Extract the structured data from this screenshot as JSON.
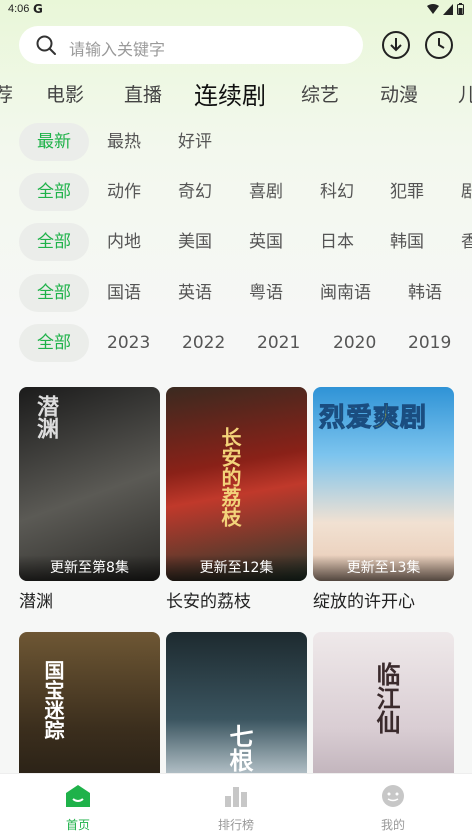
{
  "status_bar": {
    "time": "4:06",
    "carrier_icon": "G"
  },
  "search": {
    "placeholder": "请输入关键字"
  },
  "top_icons": [
    "download-icon",
    "history-icon"
  ],
  "tabs": [
    "荐",
    "电影",
    "直播",
    "连续剧",
    "综艺",
    "动漫",
    "儿"
  ],
  "active_tab": "连续剧",
  "filters": {
    "sort": [
      "最新",
      "最热",
      "好评"
    ],
    "genre": [
      "全部",
      "动作",
      "奇幻",
      "喜剧",
      "科幻",
      "犯罪",
      "剧"
    ],
    "region": [
      "全部",
      "内地",
      "美国",
      "英国",
      "日本",
      "韩国",
      "香"
    ],
    "language": [
      "全部",
      "国语",
      "英语",
      "粤语",
      "闽南语",
      "韩语"
    ],
    "year": [
      "全部",
      "2023",
      "2022",
      "2021",
      "2020",
      "2019"
    ]
  },
  "cards": [
    {
      "title": "潜渊",
      "status": "更新至第8集",
      "poster_text": "潜渊",
      "colors": [
        "#2a2a2a",
        "#6b6b66"
      ]
    },
    {
      "title": "长安的荔枝",
      "status": "更新至12集",
      "poster_text": "长安的荔枝",
      "colors": [
        "#7a1f1a",
        "#1d3b2e"
      ]
    },
    {
      "title": "绽放的许开心",
      "status": "更新至13集",
      "poster_text": "烈爱爽剧",
      "colors": [
        "#3fa0dc",
        "#f3d9c4"
      ]
    },
    {
      "title": "",
      "status": "",
      "poster_text": "国宝迷踪",
      "colors": [
        "#4a3a22",
        "#1e1a14"
      ]
    },
    {
      "title": "",
      "status": "",
      "poster_text": "七根",
      "colors": [
        "#1c2a30",
        "#c8d3d8"
      ]
    },
    {
      "title": "",
      "status": "",
      "poster_text": "临江仙",
      "colors": [
        "#e9e4e6",
        "#b5a9b2"
      ]
    }
  ],
  "bottom_nav": [
    {
      "label": "首页",
      "icon": "home-icon",
      "active": true
    },
    {
      "label": "排行榜",
      "icon": "ranking-icon",
      "active": false
    },
    {
      "label": "我的",
      "icon": "profile-icon",
      "active": false
    }
  ],
  "colors": {
    "accent": "#1fb24a",
    "chip_bg": "#ebedea"
  }
}
